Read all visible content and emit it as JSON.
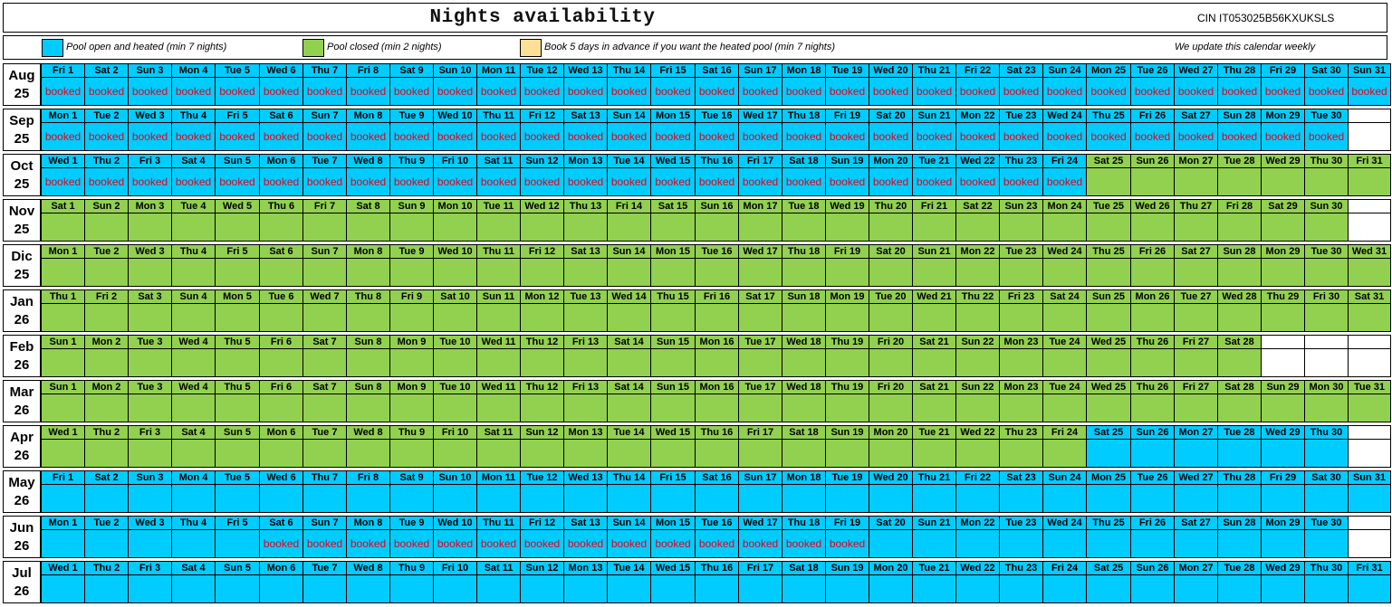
{
  "title": "Nights availability",
  "cin": "CIN IT053025B56KXUKSLS",
  "colors": {
    "blue": "#00ccff",
    "green": "#92d050",
    "beige": "#ffdf96"
  },
  "legend": {
    "pool_open": "Pool open and heated (min 7 nights)",
    "pool_closed": "Pool closed (min 2 nights)",
    "book_advance": "Book 5 days in advance if you want the heated pool (min 7 nights)",
    "update_note": "We update this calendar weekly"
  },
  "booked_label": "booked",
  "months": [
    {
      "name": "Aug",
      "year": "25",
      "days": [
        "Fri 1",
        "Sat 2",
        "Sun 3",
        "Mon 4",
        "Tue 5",
        "Wed 6",
        "Thu 7",
        "Fri 8",
        "Sat 9",
        "Sun 10",
        "Mon 11",
        "Tue 12",
        "Wed 13",
        "Thu 14",
        "Fri 15",
        "Sat 16",
        "Sun 17",
        "Mon 18",
        "Tue 19",
        "Wed 20",
        "Thu 21",
        "Fri 22",
        "Sat 23",
        "Sun 24",
        "Mon 25",
        "Tue 26",
        "Wed 27",
        "Thu 28",
        "Fri 29",
        "Sat 30",
        "Sun 31"
      ],
      "runs": [
        [
          "blue",
          31
        ]
      ],
      "booked": [
        1,
        31
      ]
    },
    {
      "name": "Sep",
      "year": "25",
      "days": [
        "Mon 1",
        "Tue 2",
        "Wed 3",
        "Thu 4",
        "Fri 5",
        "Sat 6",
        "Sun 7",
        "Mon 8",
        "Tue 9",
        "Wed 10",
        "Thu 11",
        "Fri 12",
        "Sat 13",
        "Sun 14",
        "Mon 15",
        "Tue 16",
        "Wed 17",
        "Thu 18",
        "Fri 19",
        "Sat 20",
        "Sun 21",
        "Mon 22",
        "Tue 23",
        "Wed 24",
        "Thu 25",
        "Fri 26",
        "Sat 27",
        "Sun 28",
        "Mon 29",
        "Tue 30"
      ],
      "runs": [
        [
          "blue",
          30
        ]
      ],
      "booked": [
        1,
        30
      ]
    },
    {
      "name": "Oct",
      "year": "25",
      "days": [
        "Wed 1",
        "Thu 2",
        "Fri 3",
        "Sat 4",
        "Sun 5",
        "Mon 6",
        "Tue 7",
        "Wed 8",
        "Thu 9",
        "Fri 10",
        "Sat 11",
        "Sun 12",
        "Mon 13",
        "Tue 14",
        "Wed 15",
        "Thu 16",
        "Fri 17",
        "Sat 18",
        "Sun 19",
        "Mon 20",
        "Tue 21",
        "Wed 22",
        "Thu 23",
        "Fri 24",
        "Sat 25",
        "Sun 26",
        "Mon 27",
        "Tue 28",
        "Wed 29",
        "Thu 30",
        "Fri 31"
      ],
      "runs": [
        [
          "blue",
          24
        ],
        [
          "green",
          7
        ]
      ],
      "booked": [
        1,
        24
      ]
    },
    {
      "name": "Nov",
      "year": "25",
      "days": [
        "Sat 1",
        "Sun 2",
        "Mon 3",
        "Tue 4",
        "Wed 5",
        "Thu 6",
        "Fri 7",
        "Sat 8",
        "Sun 9",
        "Mon 10",
        "Tue 11",
        "Wed 12",
        "Thu 13",
        "Fri 14",
        "Sat 15",
        "Sun 16",
        "Mon 17",
        "Tue 18",
        "Wed 19",
        "Thu 20",
        "Fri 21",
        "Sat 22",
        "Sun 23",
        "Mon 24",
        "Tue 25",
        "Wed 26",
        "Thu 27",
        "Fri 28",
        "Sat 29",
        "Sun 30"
      ],
      "runs": [
        [
          "green",
          30
        ]
      ],
      "booked": null
    },
    {
      "name": "Dic",
      "year": "25",
      "days": [
        "Mon 1",
        "Tue 2",
        "Wed 3",
        "Thu 4",
        "Fri 5",
        "Sat 6",
        "Sun 7",
        "Mon 8",
        "Tue 9",
        "Wed 10",
        "Thu 11",
        "Fri 12",
        "Sat 13",
        "Sun 14",
        "Mon 15",
        "Tue 16",
        "Wed 17",
        "Thu 18",
        "Fri 19",
        "Sat 20",
        "Sun 21",
        "Mon 22",
        "Tue 23",
        "Wed 24",
        "Thu 25",
        "Fri 26",
        "Sat 27",
        "Sun 28",
        "Mon 29",
        "Tue 30",
        "Wed 31"
      ],
      "runs": [
        [
          "green",
          31
        ]
      ],
      "booked": null
    },
    {
      "name": "Jan",
      "year": "26",
      "days": [
        "Thu 1",
        "Fri 2",
        "Sat 3",
        "Sun 4",
        "Mon 5",
        "Tue 6",
        "Wed 7",
        "Thu 8",
        "Fri 9",
        "Sat 10",
        "Sun 11",
        "Mon 12",
        "Tue 13",
        "Wed 14",
        "Thu 15",
        "Fri 16",
        "Sat 17",
        "Sun 18",
        "Mon 19",
        "Tue 20",
        "Wed 21",
        "Thu 22",
        "Fri 23",
        "Sat 24",
        "Sun 25",
        "Mon 26",
        "Tue 27",
        "Wed 28",
        "Thu 29",
        "Fri 30",
        "Sat 31"
      ],
      "runs": [
        [
          "green",
          31
        ]
      ],
      "booked": null
    },
    {
      "name": "Feb",
      "year": "26",
      "days": [
        "Sun 1",
        "Mon 2",
        "Tue 3",
        "Wed 4",
        "Thu 5",
        "Fri 6",
        "Sat 7",
        "Sun 8",
        "Mon 9",
        "Tue 10",
        "Wed 11",
        "Thu 12",
        "Fri 13",
        "Sat 14",
        "Sun 15",
        "Mon 16",
        "Tue 17",
        "Wed 18",
        "Thu 19",
        "Fri 20",
        "Sat 21",
        "Sun 22",
        "Mon 23",
        "Tue 24",
        "Wed 25",
        "Thu 26",
        "Fri 27",
        "Sat 28"
      ],
      "runs": [
        [
          "green",
          28
        ]
      ],
      "booked": null
    },
    {
      "name": "Mar",
      "year": "26",
      "days": [
        "Sun 1",
        "Mon 2",
        "Tue 3",
        "Wed 4",
        "Thu 5",
        "Fri 6",
        "Sat 7",
        "Sun 8",
        "Mon 9",
        "Tue 10",
        "Wed 11",
        "Thu 12",
        "Fri 13",
        "Sat 14",
        "Sun 15",
        "Mon 16",
        "Tue 17",
        "Wed 18",
        "Thu 19",
        "Fri 20",
        "Sat 21",
        "Sun 22",
        "Mon 23",
        "Tue 24",
        "Wed 25",
        "Thu 26",
        "Fri 27",
        "Sat 28",
        "Sun 29",
        "Mon 30",
        "Tue 31"
      ],
      "runs": [
        [
          "green",
          31
        ]
      ],
      "booked": null
    },
    {
      "name": "Apr",
      "year": "26",
      "days": [
        "Wed 1",
        "Thu 2",
        "Fri 3",
        "Sat 4",
        "Sun 5",
        "Mon 6",
        "Tue 7",
        "Wed 8",
        "Thu 9",
        "Fri 10",
        "Sat 11",
        "Sun 12",
        "Mon 13",
        "Tue 14",
        "Wed 15",
        "Thu 16",
        "Fri 17",
        "Sat 18",
        "Sun 19",
        "Mon 20",
        "Tue 21",
        "Wed 22",
        "Thu 23",
        "Fri 24",
        "Sat 25",
        "Sun 26",
        "Mon 27",
        "Tue 28",
        "Wed 29",
        "Thu 30"
      ],
      "runs": [
        [
          "green",
          24
        ],
        [
          "blue",
          6
        ]
      ],
      "booked": null
    },
    {
      "name": "May",
      "year": "26",
      "days": [
        "Fri 1",
        "Sat 2",
        "Sun 3",
        "Mon 4",
        "Tue 5",
        "Wed 6",
        "Thu 7",
        "Fri 8",
        "Sat 9",
        "Sun 10",
        "Mon 11",
        "Tue 12",
        "Wed 13",
        "Thu 14",
        "Fri 15",
        "Sat 16",
        "Sun 17",
        "Mon 18",
        "Tue 19",
        "Wed 20",
        "Thu 21",
        "Fri 22",
        "Sat 23",
        "Sun 24",
        "Mon 25",
        "Tue 26",
        "Wed 27",
        "Thu 28",
        "Fri 29",
        "Sat 30",
        "Sun 31"
      ],
      "runs": [
        [
          "blue",
          31
        ]
      ],
      "booked": null
    },
    {
      "name": "Jun",
      "year": "26",
      "days": [
        "Mon 1",
        "Tue 2",
        "Wed 3",
        "Thu 4",
        "Fri 5",
        "Sat 6",
        "Sun 7",
        "Mon 8",
        "Tue 9",
        "Wed 10",
        "Thu 11",
        "Fri 12",
        "Sat 13",
        "Sun 14",
        "Mon 15",
        "Tue 16",
        "Wed 17",
        "Thu 18",
        "Fri 19",
        "Sat 20",
        "Sun 21",
        "Mon 22",
        "Tue 23",
        "Wed 24",
        "Thu 25",
        "Fri 26",
        "Sat 27",
        "Sun 28",
        "Mon 29",
        "Tue 30"
      ],
      "runs": [
        [
          "blue",
          30
        ]
      ],
      "booked": [
        6,
        19
      ]
    },
    {
      "name": "Jul",
      "year": "26",
      "days": [
        "Wed 1",
        "Thu 2",
        "Fri 3",
        "Sat 4",
        "Sun 5",
        "Mon 6",
        "Tue 7",
        "Wed 8",
        "Thu 9",
        "Fri 10",
        "Sat 11",
        "Sun 12",
        "Mon 13",
        "Tue 14",
        "Wed 15",
        "Thu 16",
        "Fri 17",
        "Sat 18",
        "Sun 19",
        "Mon 20",
        "Tue 21",
        "Wed 22",
        "Thu 23",
        "Fri 24",
        "Sat 25",
        "Sun 26",
        "Mon 27",
        "Tue 28",
        "Wed 29",
        "Thu 30",
        "Fri 31"
      ],
      "runs": [
        [
          "blue",
          31
        ]
      ],
      "booked": null
    }
  ]
}
